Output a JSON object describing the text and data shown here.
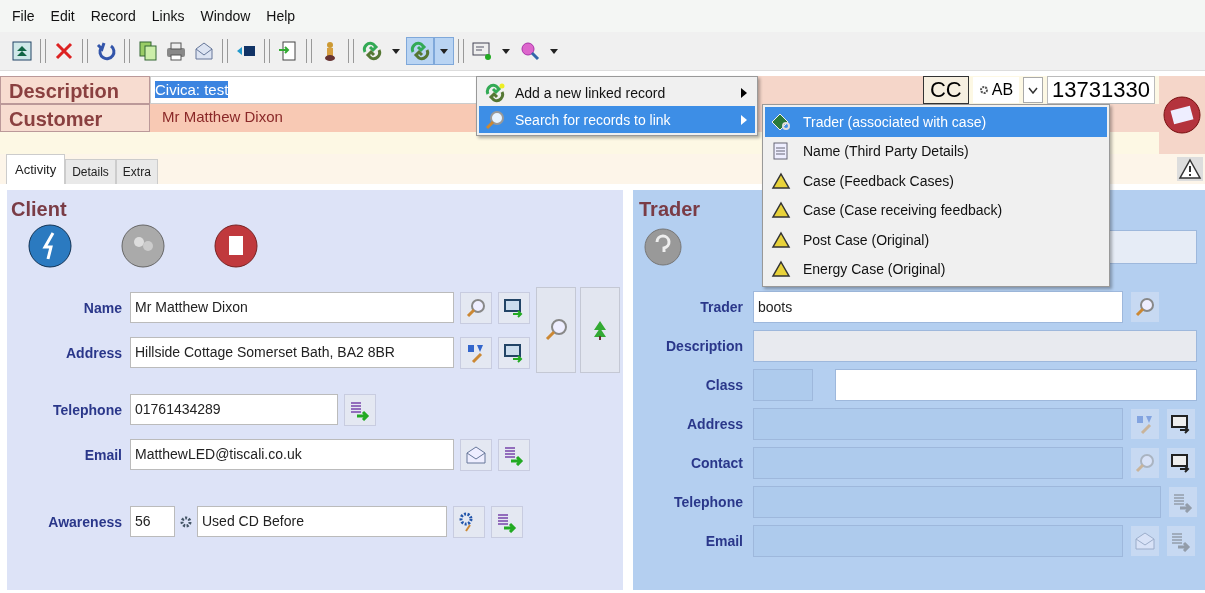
{
  "menu_bar": [
    "File",
    "Edit",
    "Record",
    "Links",
    "Window",
    "Help"
  ],
  "toolbar": [
    [
      {
        "kind": "top",
        "pressed": false
      }
    ],
    [
      {
        "kind": "delete",
        "pressed": false
      }
    ],
    [
      {
        "kind": "undo",
        "pressed": false
      }
    ],
    [
      {
        "kind": "copy",
        "pressed": false
      },
      {
        "kind": "print",
        "pressed": false
      },
      {
        "kind": "mail",
        "pressed": false
      }
    ],
    [
      {
        "kind": "move",
        "pressed": false
      }
    ],
    [
      {
        "kind": "doc",
        "pressed": false
      }
    ],
    [
      {
        "kind": "figure",
        "pressed": false
      }
    ],
    [
      {
        "kind": "link",
        "pressed": false,
        "dropdown": true
      },
      {
        "kind": "link",
        "pressed": true,
        "dropdown": true
      }
    ],
    [
      {
        "kind": "screen",
        "pressed": false,
        "dropdown": true
      },
      {
        "kind": "magnifier",
        "pressed": false,
        "dropdown": true
      }
    ]
  ],
  "header": {
    "description": {
      "label": "Description",
      "value": "Civica: test",
      "value_selected": true
    },
    "customer": {
      "label": "Customer",
      "value": "Mr Matthew Dixon"
    },
    "code": "CC",
    "mode": "AB",
    "reference": "13731330"
  },
  "tabs": [
    {
      "label": "Activity",
      "selected": true
    },
    {
      "label": "Details",
      "selected": false
    },
    {
      "label": "Extra",
      "selected": false
    }
  ],
  "client": {
    "title": "Client",
    "name": {
      "label": "Name",
      "value": "Mr Matthew Dixon"
    },
    "address": {
      "label": "Address",
      "value": "Hillside Cottage  Somerset Bath, BA2 8BR"
    },
    "telephone": {
      "label": "Telephone",
      "value": "01761434289"
    },
    "email": {
      "label": "Email",
      "value": "MatthewLED@tiscali.co.uk"
    },
    "awareness": {
      "label": "Awareness",
      "code": "56",
      "value": "Used CD Before"
    }
  },
  "trader": {
    "title": "Trader",
    "trader": {
      "label": "Trader",
      "value": "boots"
    },
    "description": {
      "label": "Description",
      "disabled": true
    },
    "class": {
      "label": "Class"
    },
    "address": {
      "label": "Address",
      "disabled": true
    },
    "contact": {
      "label": "Contact",
      "disabled": true
    },
    "telephone": {
      "label": "Telephone",
      "disabled": true
    },
    "email": {
      "label": "Email",
      "disabled": true
    }
  },
  "link_menu": {
    "items": [
      {
        "label": "Add a new linked record",
        "kind": "add",
        "selected": false
      },
      {
        "label": "Search for records to link",
        "kind": "search",
        "selected": true
      }
    ]
  },
  "link_submenu": {
    "items": [
      {
        "label": "Trader (associated with case)",
        "kind": "trader",
        "selected": true
      },
      {
        "label": "Name (Third Party Details)",
        "kind": "name",
        "selected": false
      },
      {
        "label": "Case (Feedback Cases)",
        "kind": "case",
        "selected": false
      },
      {
        "label": "Case (Case receiving feedback)",
        "kind": "case",
        "selected": false
      },
      {
        "label": "Post Case (Original)",
        "kind": "case",
        "selected": false
      },
      {
        "label": "Energy Case (Original)",
        "kind": "case",
        "selected": false
      }
    ]
  }
}
